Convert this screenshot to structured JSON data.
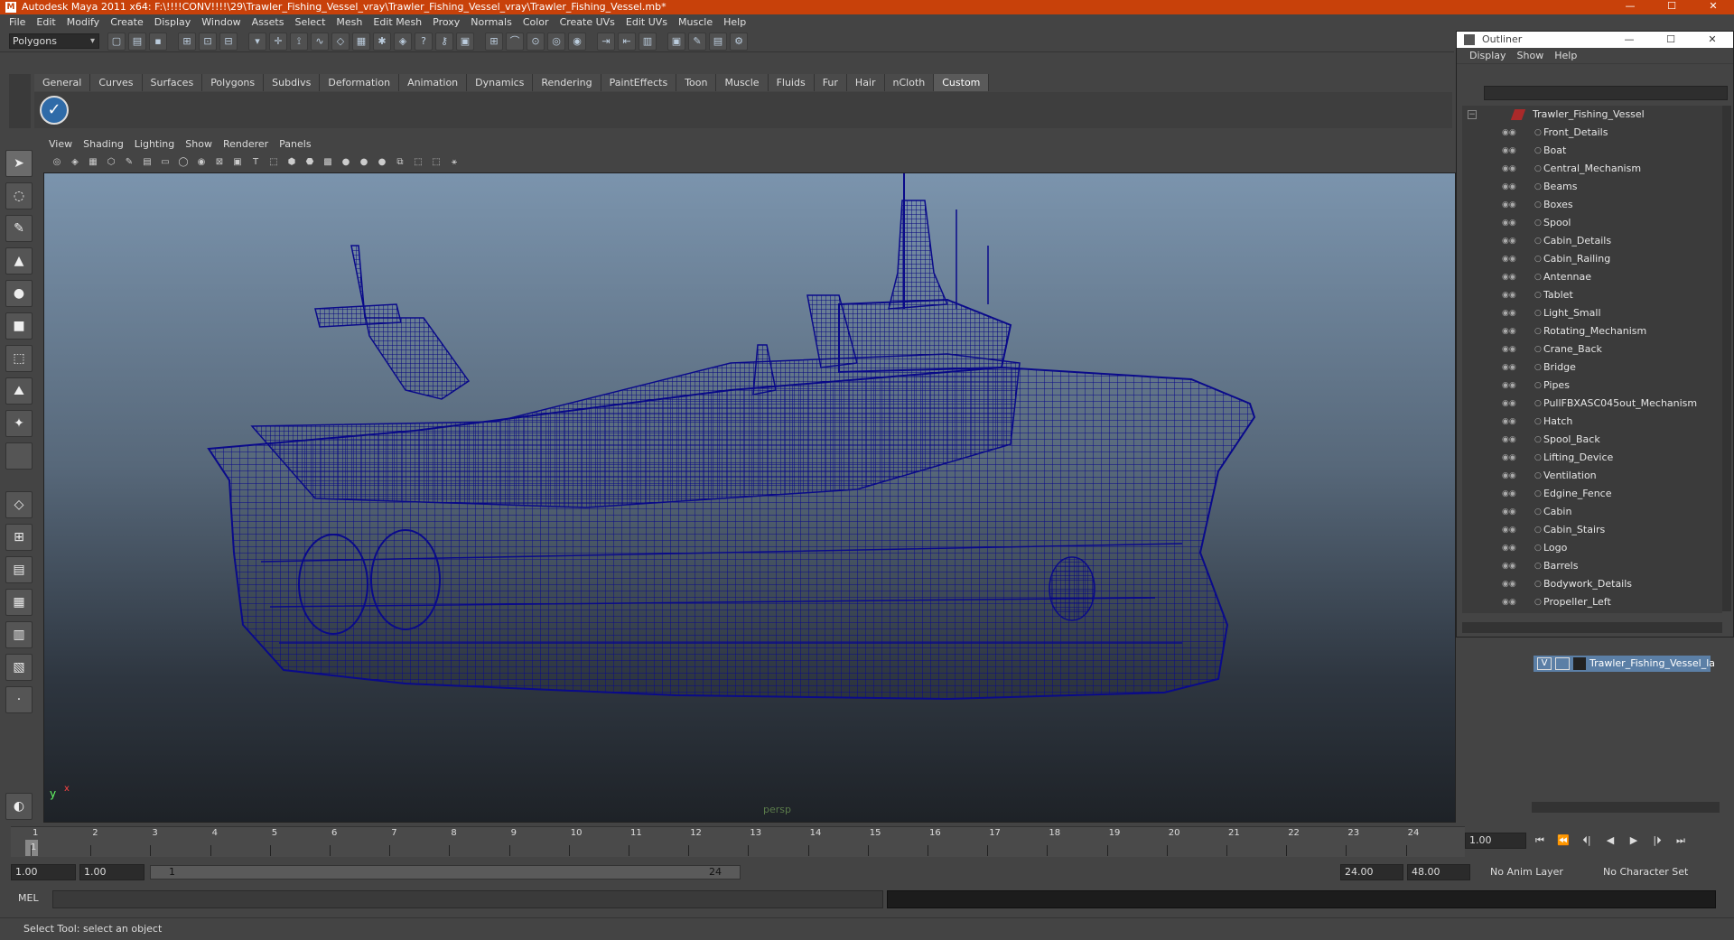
{
  "window": {
    "title": "Autodesk Maya 2011 x64: F:\\!!!!CONV!!!!\\29\\Trawler_Fishing_Vessel_vray\\Trawler_Fishing_Vessel_vray\\Trawler_Fishing_Vessel.mb*",
    "controls": [
      "—",
      "☐",
      "✕"
    ]
  },
  "menubar": [
    "File",
    "Edit",
    "Modify",
    "Create",
    "Display",
    "Window",
    "Assets",
    "Select",
    "Mesh",
    "Edit Mesh",
    "Proxy",
    "Normals",
    "Color",
    "Create UVs",
    "Edit UVs",
    "Muscle",
    "Help"
  ],
  "statusline": {
    "mode": "Polygons"
  },
  "shelf": {
    "tabs": [
      "General",
      "Curves",
      "Surfaces",
      "Polygons",
      "Subdivs",
      "Deformation",
      "Animation",
      "Dynamics",
      "Rendering",
      "PaintEffects",
      "Toon",
      "Muscle",
      "Fluids",
      "Fur",
      "Hair",
      "nCloth",
      "Custom"
    ],
    "active_tab": "Custom"
  },
  "panel": {
    "menu": [
      "View",
      "Shading",
      "Lighting",
      "Show",
      "Renderer",
      "Panels"
    ],
    "camera_label": "persp",
    "axis_y": "y",
    "axis_x": "x"
  },
  "outliner": {
    "title": "Outliner",
    "controls": [
      "—",
      "☐",
      "✕"
    ],
    "menu": [
      "Display",
      "Show",
      "Help"
    ],
    "root": "Trawler_Fishing_Vessel",
    "items": [
      "Front_Details",
      "Boat",
      "Central_Mechanism",
      "Beams",
      "Boxes",
      "Spool",
      "Cabin_Details",
      "Cabin_Railing",
      "Antennae",
      "Tablet",
      "Light_Small",
      "Rotating_Mechanism",
      "Crane_Back",
      "Bridge",
      "Pipes",
      "PullFBXASC045out_Mechanism",
      "Hatch",
      "Spool_Back",
      "Lifting_Device",
      "Ventilation",
      "Edgine_Fence",
      "Cabin",
      "Cabin_Stairs",
      "Logo",
      "Barrels",
      "Bodywork_Details",
      "Propeller_Left"
    ]
  },
  "layers": {
    "row_visible": "V",
    "row_name": "Trawler_Fishing_Vessel_la"
  },
  "timeline": {
    "ticks": [
      "1",
      "2",
      "3",
      "4",
      "5",
      "6",
      "7",
      "8",
      "9",
      "10",
      "11",
      "12",
      "13",
      "14",
      "15",
      "16",
      "17",
      "18",
      "19",
      "20",
      "21",
      "22",
      "23",
      "24"
    ],
    "current_frame_marker": "1",
    "current_time": "1.00",
    "play_controls": [
      "⏮",
      "⏪",
      "⏴|",
      "◀",
      "▶",
      "|⏵",
      "⏭"
    ]
  },
  "range": {
    "start_time": "1.00",
    "start_range": "1.00",
    "bar_start": "1",
    "bar_end": "24",
    "end_range": "24.00",
    "end_time": "48.00",
    "anim_layer": "No Anim Layer",
    "character_set": "No Character Set"
  },
  "command": {
    "language": "MEL"
  },
  "help": {
    "text": "Select Tool: select an object"
  }
}
